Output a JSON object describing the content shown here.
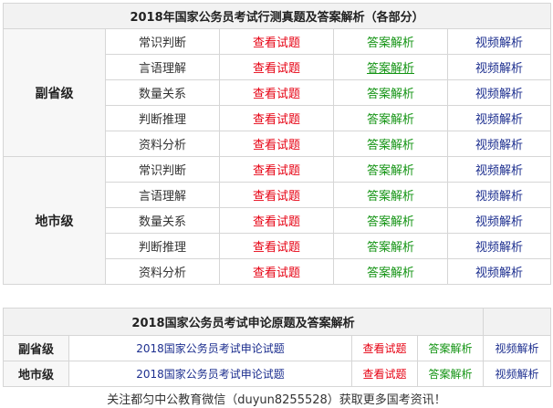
{
  "table1": {
    "title": "2018年国家公务员考试行测真题及答案解析（各部分）",
    "groups": [
      {
        "name": "副省级",
        "rows": [
          {
            "subject": "常识判断",
            "view": "查看试题",
            "answer": "答案解析",
            "video": "视频解析"
          },
          {
            "subject": "言语理解",
            "view": "查看试题",
            "answer": "答案解析",
            "video": "视频解析"
          },
          {
            "subject": "数量关系",
            "view": "查看试题",
            "answer": "答案解析",
            "video": "视频解析"
          },
          {
            "subject": "判断推理",
            "view": "查看试题",
            "answer": "答案解析",
            "video": "视频解析"
          },
          {
            "subject": "资料分析",
            "view": "查看试题",
            "answer": "答案解析",
            "video": "视频解析"
          }
        ]
      },
      {
        "name": "地市级",
        "rows": [
          {
            "subject": "常识判断",
            "view": "查看试题",
            "answer": "答案解析",
            "video": "视频解析"
          },
          {
            "subject": "言语理解",
            "view": "查看试题",
            "answer": "答案解析",
            "video": "视频解析"
          },
          {
            "subject": "数量关系",
            "view": "查看试题",
            "answer": "答案解析",
            "video": "视频解析"
          },
          {
            "subject": "判断推理",
            "view": "查看试题",
            "answer": "答案解析",
            "video": "视频解析"
          },
          {
            "subject": "资料分析",
            "view": "查看试题",
            "answer": "答案解析",
            "video": "视频解析"
          }
        ]
      }
    ]
  },
  "table2": {
    "title": "2018国家公务员考试申论原题及答案解析",
    "rows": [
      {
        "group": "副省级",
        "paper": "2018国家公务员考试申论试题",
        "view": "查看试题",
        "answer": "答案解析",
        "video": "视频解析"
      },
      {
        "group": "地市级",
        "paper": "2018国家公务员考试申论试题",
        "view": "查看试题",
        "answer": "答案解析",
        "video": "视频解析"
      }
    ]
  },
  "footer": "关注都匀中公教育微信（duyun8255528）获取更多国考资讯！",
  "colors": {
    "view": "#e60012",
    "answer": "#149414",
    "video": "#1d2f8f",
    "border": "#d6d6d6"
  }
}
